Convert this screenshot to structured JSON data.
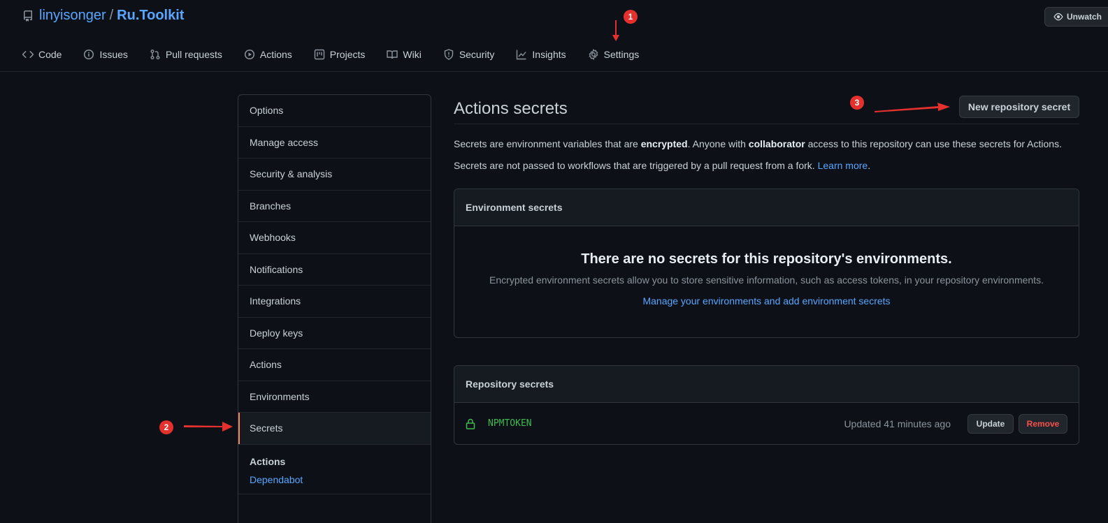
{
  "repo": {
    "owner": "linyisonger",
    "separator": "/",
    "name": "Ru.Toolkit",
    "watch_label": "Unwatch"
  },
  "tabs": [
    {
      "label": "Code",
      "icon": "code-icon"
    },
    {
      "label": "Issues",
      "icon": "issue-icon"
    },
    {
      "label": "Pull requests",
      "icon": "pull-request-icon"
    },
    {
      "label": "Actions",
      "icon": "play-icon"
    },
    {
      "label": "Projects",
      "icon": "project-icon"
    },
    {
      "label": "Wiki",
      "icon": "book-icon"
    },
    {
      "label": "Security",
      "icon": "shield-icon"
    },
    {
      "label": "Insights",
      "icon": "graph-icon"
    },
    {
      "label": "Settings",
      "icon": "gear-icon"
    }
  ],
  "sidebar": {
    "items": [
      {
        "label": "Options"
      },
      {
        "label": "Manage access"
      },
      {
        "label": "Security & analysis"
      },
      {
        "label": "Branches"
      },
      {
        "label": "Webhooks"
      },
      {
        "label": "Notifications"
      },
      {
        "label": "Integrations"
      },
      {
        "label": "Deploy keys"
      },
      {
        "label": "Actions"
      },
      {
        "label": "Environments"
      },
      {
        "label": "Secrets",
        "selected": true
      }
    ],
    "sub_heading": "Actions",
    "sub_link": "Dependabot"
  },
  "main": {
    "title": "Actions secrets",
    "new_secret_button": "New repository secret",
    "desc1": {
      "part1": "Secrets are environment variables that are ",
      "bold1": "encrypted",
      "part2": ". Anyone with ",
      "bold2": "collaborator",
      "part3": " access to this repository can use these secrets for Actions."
    },
    "desc2": {
      "text": "Secrets are not passed to workflows that are triggered by a pull request from a fork. ",
      "link": "Learn more",
      "end": "."
    },
    "env_box": {
      "header": "Environment secrets",
      "empty_title": "There are no secrets for this repository's environments.",
      "empty_desc": "Encrypted environment secrets allow you to store sensitive information, such as access tokens, in your repository environments.",
      "empty_link": "Manage your environments and add environment secrets"
    },
    "repo_box": {
      "header": "Repository secrets",
      "secrets": [
        {
          "name": "NPMTOKEN",
          "updated": "Updated 41 minutes ago",
          "update_label": "Update",
          "remove_label": "Remove"
        }
      ]
    }
  },
  "annotations": {
    "badge1": "1",
    "badge2": "2",
    "badge3": "3",
    "color": "#e5312d"
  }
}
